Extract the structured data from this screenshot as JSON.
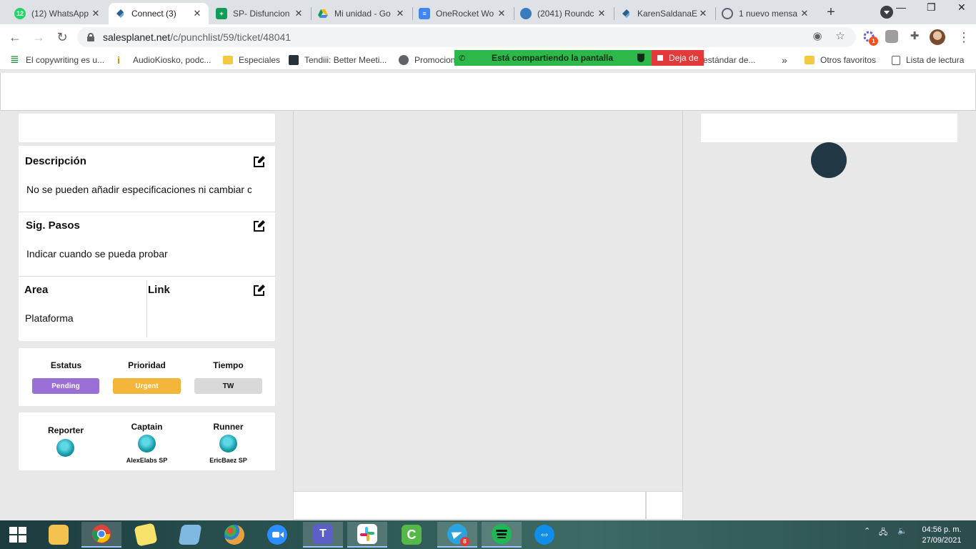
{
  "browser": {
    "tabs": [
      {
        "title": "(12) WhatsApp",
        "favicon": "whatsapp-icon",
        "color": "#25d366",
        "badge": "12"
      },
      {
        "title": "Connect (3)",
        "favicon": "connect-icon",
        "color": "#2c5f8a"
      },
      {
        "title": "SP- Disfuncion",
        "favicon": "sheets-icon",
        "color": "#0f9d58"
      },
      {
        "title": "Mi unidad - Go",
        "favicon": "drive-icon",
        "color": "#fbbc04"
      },
      {
        "title": "OneRocket Wo",
        "favicon": "docs-icon",
        "color": "#4285f4"
      },
      {
        "title": "(2041) Roundc",
        "favicon": "roundcube-icon",
        "color": "#3a7bbf"
      },
      {
        "title": "KarenSaldanaE",
        "favicon": "connect-icon",
        "color": "#2c5f8a"
      },
      {
        "title": "1 nuevo mensa",
        "favicon": "mail-icon",
        "color": "#5f6368"
      }
    ],
    "url_host": "salesplanet.net",
    "url_path": "/c/punchlist/59/ticket/48041",
    "extension_badge": "1",
    "bookmarks": [
      {
        "label": "El copywriting es u...",
        "icon": "list-icon",
        "color": "#1e8e3e"
      },
      {
        "label": "AudioKiosko, podc...",
        "icon": "audiokiosko-icon",
        "color": "#f57c00"
      },
      {
        "label": "Especiales",
        "icon": "folder-icon",
        "color": "#f5c842"
      },
      {
        "label": "Tendiii: Better Meeti...",
        "icon": "tendiii-icon",
        "color": "#263238"
      },
      {
        "label": "Promocion",
        "icon": "globe-icon",
        "color": "#5f6368"
      },
      {
        "label": "estándar de...",
        "icon": "page-icon",
        "color": "#9e9e9e"
      }
    ],
    "bookmarks_more": "»",
    "other_favorites": "Otros favoritos",
    "reading_list": "Lista de lectura",
    "screen_share": {
      "text": "Está compartiendo la pantalla",
      "stop": "Deja de"
    }
  },
  "ticket": {
    "description": {
      "title": "Descripción",
      "text": "No se pueden añadir especificaciones ni cambiar c"
    },
    "next_steps": {
      "title": "Sig. Pasos",
      "text": "Indicar cuando se pueda probar"
    },
    "area": {
      "title": "Area",
      "value": "Plataforma"
    },
    "link": {
      "title": "Link",
      "value": ""
    },
    "status": {
      "label": "Estatus",
      "value": "Pending",
      "color": "#9a6fd6"
    },
    "priority": {
      "label": "Prioridad",
      "value": "Urgent",
      "color": "#f4b63a"
    },
    "time": {
      "label": "Tiempo",
      "value": "TW",
      "color": "#d9d9d9"
    },
    "reporter": {
      "label": "Reporter",
      "name": ""
    },
    "captain": {
      "label": "Captain",
      "name": "AlexElabs SP"
    },
    "runner": {
      "label": "Runner",
      "name": "EricBaez SP"
    }
  },
  "taskbar": {
    "apps": [
      {
        "name": "file-explorer-icon",
        "color": "#f2c14e"
      },
      {
        "name": "chrome-icon",
        "color": "#4285f4",
        "open": true
      },
      {
        "name": "sticky-notes-icon",
        "color": "#f7e36b"
      },
      {
        "name": "notepad-icon",
        "color": "#7fb8e0"
      },
      {
        "name": "paint-icon",
        "color": "#e9a23b"
      },
      {
        "name": "zoom-icon",
        "color": "#2d8cff"
      },
      {
        "name": "teams-icon",
        "color": "#5b5fc7",
        "open": true
      },
      {
        "name": "slack-icon",
        "color": "#ffffff",
        "open": true
      },
      {
        "name": "camtasia-icon",
        "color": "#56b848"
      },
      {
        "name": "telegram-icon",
        "color": "#2aa3df",
        "badge": "8",
        "open": true
      },
      {
        "name": "spotify-icon",
        "color": "#1db954",
        "open": true
      },
      {
        "name": "teamviewer-icon",
        "color": "#0e8ee9"
      }
    ],
    "time": "04:56 p. m.",
    "date": "27/09/2021"
  }
}
